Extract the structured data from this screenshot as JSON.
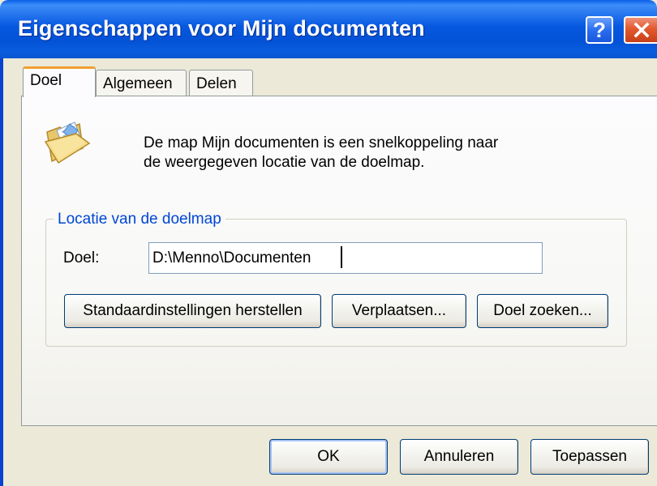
{
  "window": {
    "title": "Eigenschappen voor Mijn documenten"
  },
  "titlebar": {
    "help_label": "?",
    "close_label": "×"
  },
  "tabs": [
    {
      "label": "Doel",
      "active": true
    },
    {
      "label": "Algemeen",
      "active": false
    },
    {
      "label": "Delen",
      "active": false
    }
  ],
  "content": {
    "icon": "folder-documents-icon",
    "description_line1": "De map Mijn documenten is een snelkoppeling naar",
    "description_line2": "de weergegeven locatie van de doelmap."
  },
  "group": {
    "legend": "Locatie van de doelmap",
    "doel_label": "Doel:",
    "doel_value": "D:\\Menno\\Documenten",
    "buttons": {
      "restore": "Standaardinstellingen herstellen",
      "move": "Verplaatsen...",
      "find": "Doel zoeken..."
    }
  },
  "footer": {
    "ok": "OK",
    "cancel": "Annuleren",
    "apply": "Toepassen"
  },
  "colors": {
    "titlebar": "#0758e0",
    "accent_tab": "#f0a031",
    "group_legend": "#0046d5",
    "background": "#ece9d8"
  }
}
